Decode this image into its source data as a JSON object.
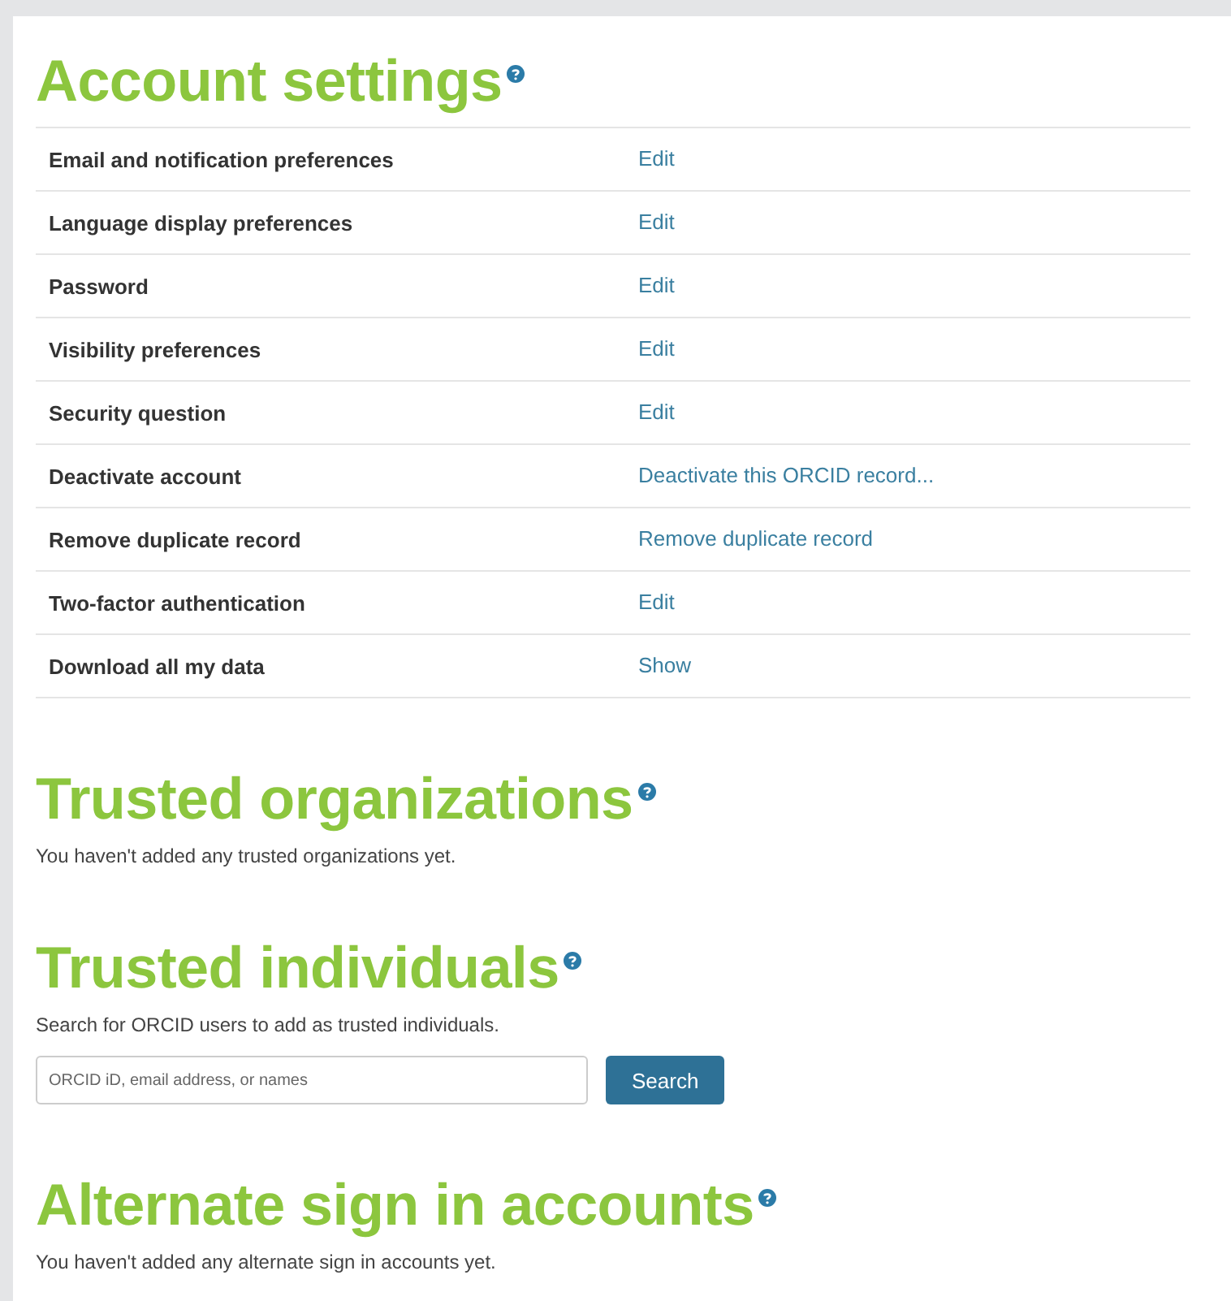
{
  "sections": [
    {
      "kind": "table",
      "title": "Account settings",
      "rows": [
        {
          "label": "Email and notification preferences",
          "action": "Edit"
        },
        {
          "label": "Language display preferences",
          "action": "Edit"
        },
        {
          "label": "Password",
          "action": "Edit"
        },
        {
          "label": "Visibility preferences",
          "action": "Edit"
        },
        {
          "label": "Security question",
          "action": "Edit"
        },
        {
          "label": "Deactivate account",
          "action": "Deactivate this ORCID record..."
        },
        {
          "label": "Remove duplicate record",
          "action": "Remove duplicate record"
        },
        {
          "label": "Two-factor authentication",
          "action": "Edit"
        },
        {
          "label": "Download all my data",
          "action": "Show"
        }
      ]
    },
    {
      "kind": "text",
      "title": "Trusted organizations",
      "text": "You haven't added any trusted organizations yet."
    },
    {
      "kind": "search",
      "title": "Trusted individuals",
      "text": "Search for ORCID users to add as trusted individuals.",
      "placeholder": "ORCID iD, email address, or names",
      "button": "Search"
    },
    {
      "kind": "text",
      "title": "Alternate sign in accounts",
      "text": "You haven't added any alternate sign in accounts yet."
    }
  ]
}
